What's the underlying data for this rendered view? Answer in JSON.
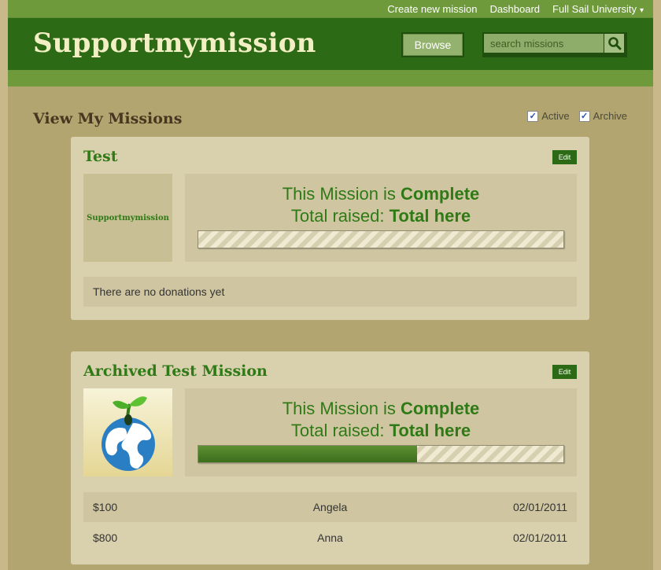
{
  "topnav": {
    "create_mission": "Create new mission",
    "dashboard": "Dashboard",
    "account": "Full Sail University",
    "account_caret": "▾"
  },
  "header": {
    "logo": "Supportmymission",
    "browse": "Browse",
    "search_placeholder": "search missions"
  },
  "page": {
    "title": "View My Missions",
    "filters": [
      {
        "label": "Active",
        "checked": true
      },
      {
        "label": "Archive",
        "checked": true
      }
    ]
  },
  "missions": [
    {
      "title": "Test",
      "edit_label": "Edit",
      "thumb_text": "Supportmymission",
      "status_prefix": "This Mission is ",
      "status_value": "Complete",
      "total_prefix": "Total raised: ",
      "total_value": "Total here",
      "progress": 0,
      "empty_text": "There are no donations yet"
    },
    {
      "title": "Archived Test Mission",
      "edit_label": "Edit",
      "status_prefix": "This Mission is ",
      "status_value": "Complete",
      "total_prefix": "Total raised: ",
      "total_value": "Total here",
      "progress": 0.6,
      "donations": [
        {
          "amount": "$100",
          "name": "Angela",
          "date": "02/01/2011"
        },
        {
          "amount": "$800",
          "name": "Anna",
          "date": "02/01/2011"
        }
      ]
    }
  ],
  "colors": {
    "brand_dark_green": "#2d6a15",
    "accent_green": "#2f7a16",
    "nav_green": "#6e9a3c",
    "card_bg": "#d9d0ad"
  }
}
